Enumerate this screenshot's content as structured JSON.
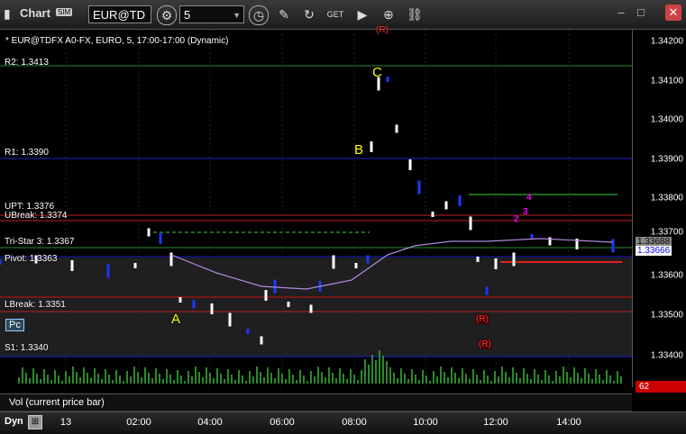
{
  "window": {
    "title": "Chart",
    "badge": "SIM"
  },
  "toolbar": {
    "symbol": "EUR@TD",
    "interval": "5"
  },
  "chart": {
    "symbol_line": "* EUR@TDFX A0-FX, EURO, 5, 17:00-17:00 (Dynamic)",
    "price_ticks": [
      "1.34200",
      "1.34100",
      "1.34000",
      "1.33900",
      "1.33800",
      "1.33700",
      "1.33600",
      "1.33500",
      "1.33400"
    ],
    "current_price_top": "1.33688",
    "current_price": "1.33666",
    "levels": [
      {
        "label": "R2: 1.3413"
      },
      {
        "label": "R1: 1.3390"
      },
      {
        "label": "UPT: 1.3376"
      },
      {
        "label": "UBreak: 1.3374"
      },
      {
        "label": "Tri-Star 3: 1.3367"
      },
      {
        "label": "Pivot: 1.3363"
      },
      {
        "label": "LBreak: 1.3351"
      },
      {
        "label": "S1: 1.3340"
      }
    ],
    "annotations": [
      "A",
      "B",
      "C"
    ],
    "markers": [
      "(R)",
      "(R)",
      "(R)",
      "2",
      "3",
      "4"
    ],
    "pc_button": "Pc"
  },
  "volume": {
    "label": "Vol (current price bar)",
    "value": "62"
  },
  "timeaxis": {
    "mode": "Dyn",
    "labels": [
      "13",
      "02:00",
      "04:00",
      "06:00",
      "08:00",
      "10:00",
      "12:00",
      "14:00"
    ]
  }
}
